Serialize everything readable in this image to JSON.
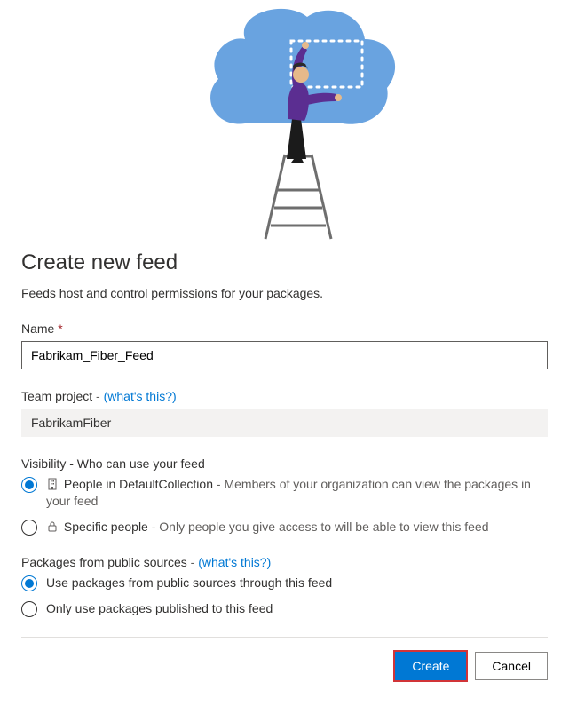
{
  "heading": "Create new feed",
  "subtitle": "Feeds host and control permissions for your packages.",
  "name_field": {
    "label": "Name",
    "required": "*",
    "value": "Fabrikam_Fiber_Feed"
  },
  "team_project": {
    "label": "Team project",
    "help_link": "(what's this?)",
    "value": "FabrikamFiber"
  },
  "visibility": {
    "label": "Visibility - Who can use your feed",
    "options": [
      {
        "selected": true,
        "icon": "organization-icon",
        "title": "People in DefaultCollection",
        "desc": "Members of your organization can view the packages in your feed"
      },
      {
        "selected": false,
        "icon": "lock-icon",
        "title": "Specific people",
        "desc": "Only people you give access to will be able to view this feed"
      }
    ]
  },
  "packages": {
    "label": "Packages from public sources",
    "help_link": "(what's this?)",
    "options": [
      {
        "selected": true,
        "label": "Use packages from public sources through this feed"
      },
      {
        "selected": false,
        "label": "Only use packages published to this feed"
      }
    ]
  },
  "buttons": {
    "create": "Create",
    "cancel": "Cancel"
  },
  "separator": " - "
}
